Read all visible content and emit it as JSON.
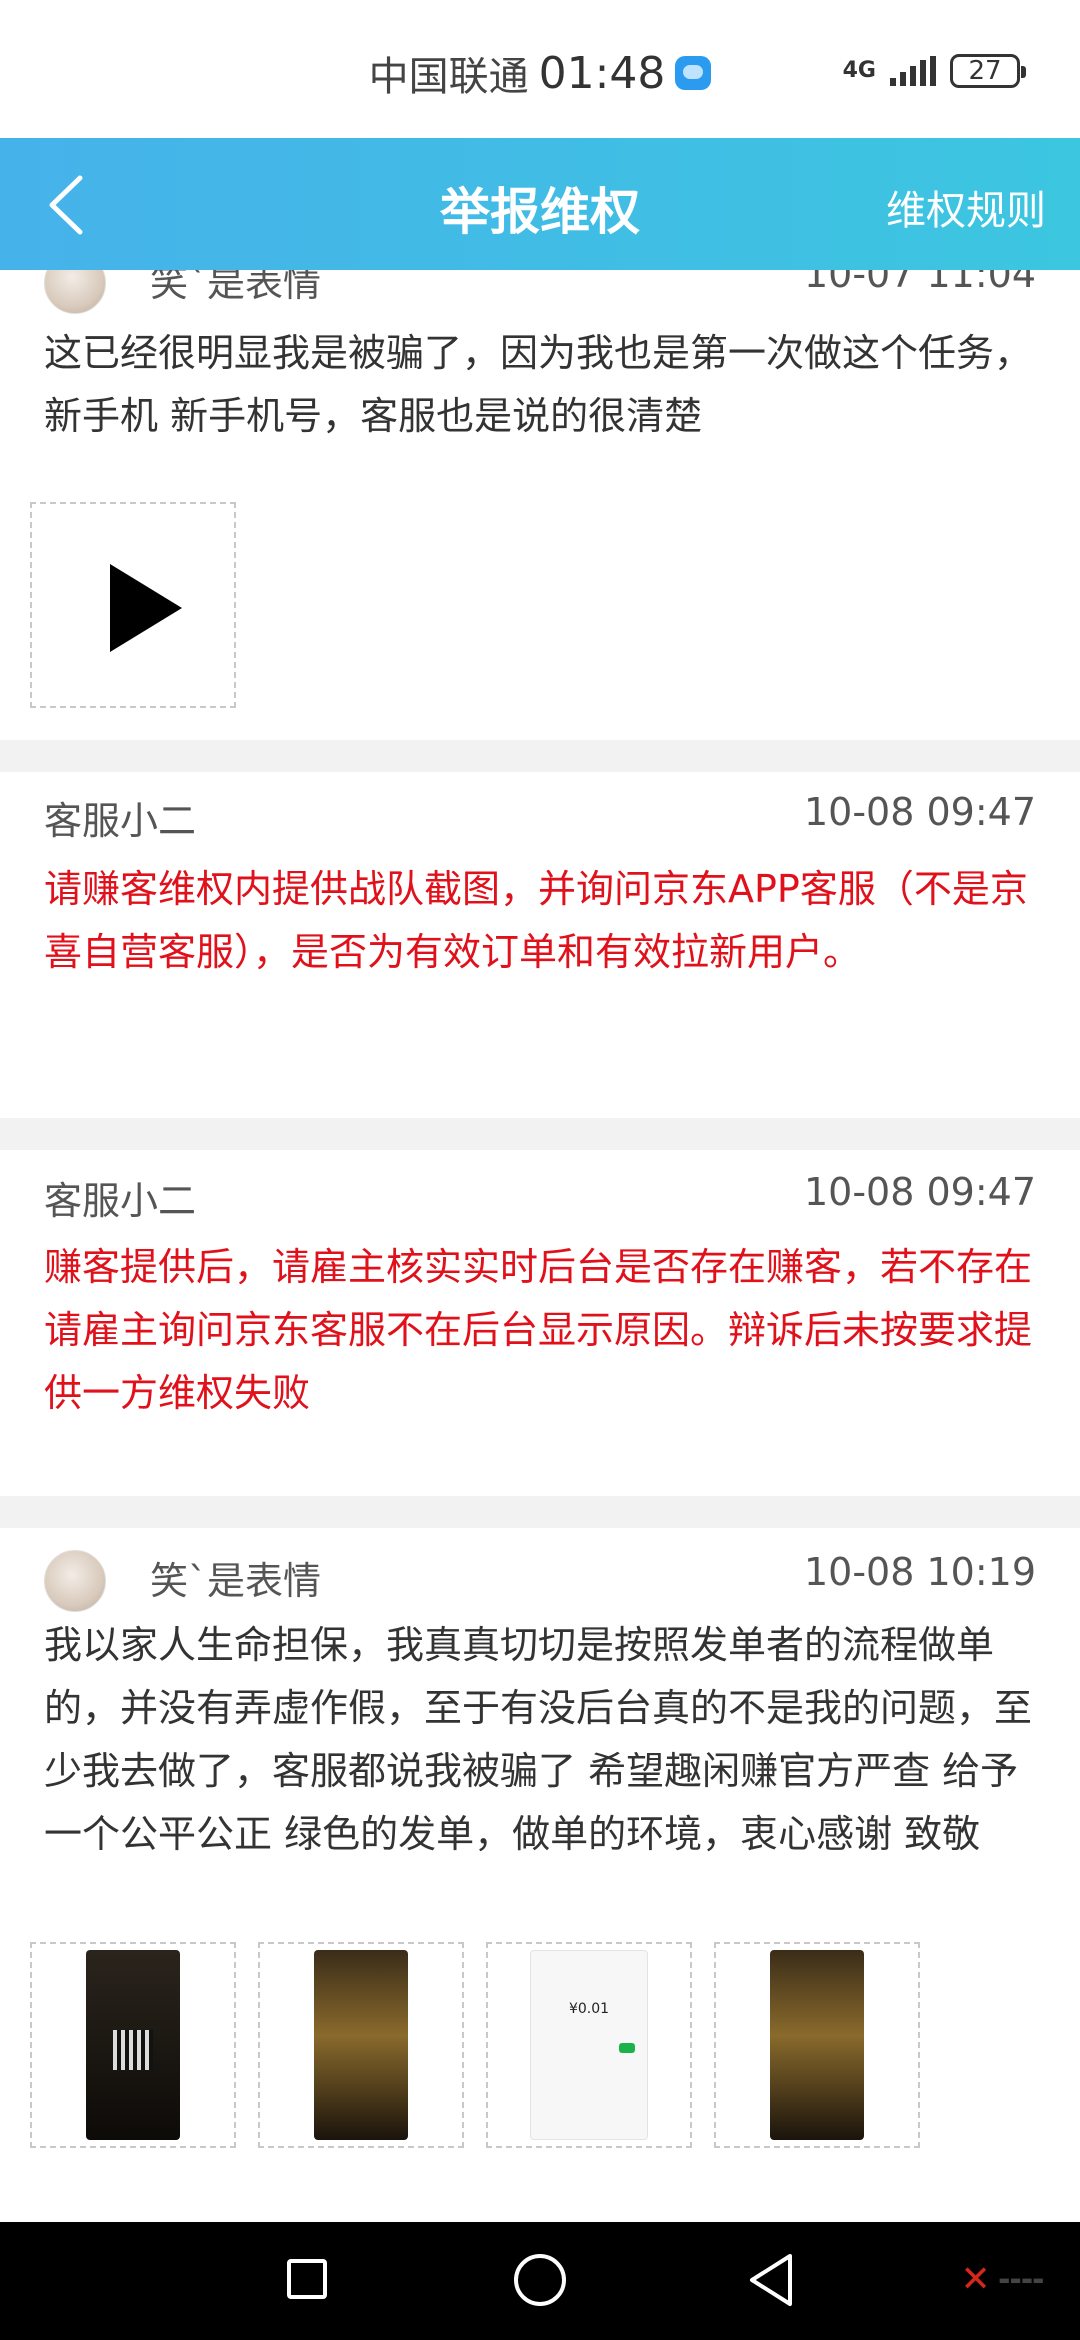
{
  "status_bar": {
    "carrier": "中国联通",
    "time": "01:48",
    "network": "4G",
    "battery": "27"
  },
  "header": {
    "title": "举报维权",
    "right_link": "维权规则"
  },
  "messages": [
    {
      "author": "笑`是表情",
      "time": "10-07 11:04",
      "text": "这已经很明显我是被骗了，因为我也是第一次做这个任务，新手机 新手机号，客服也是说的很清楚"
    },
    {
      "author": "客服小二",
      "time": "10-08 09:47",
      "text": "请赚客维权内提供战队截图，并询问京东APP客服（不是京喜自营客服），是否为有效订单和有效拉新用户。"
    },
    {
      "author": "客服小二",
      "time": "10-08 09:47",
      "text": "赚客提供后，请雇主核实实时后台是否存在赚客，若不存在请雇主询问京东客服不在后台显示原因。辩诉后未按要求提供一方维权失败"
    },
    {
      "author": "笑`是表情",
      "time": "10-08 10:19",
      "text": "我以家人生命担保，我真真切切是按照发单者的流程做单的，并没有弄虚作假，至于有没后台真的不是我的问题，至少我去做了，客服都说我被骗了 希望趣闲赚官方严查 给予一个公平公正 绿色的发单，做单的环境，衷心感谢 致敬"
    }
  ],
  "attachment_icons": [
    "play-icon"
  ],
  "screenshot_price": "¥0.01",
  "icons": {
    "back": "back-arrow-icon",
    "nav_recent": "square-icon",
    "nav_home": "circle-icon",
    "nav_back": "triangle-back-icon"
  },
  "colors": {
    "header_gradient_start": "#46b2ea",
    "header_gradient_end": "#3cc6e0",
    "staff_text": "#e0111b",
    "separator": "#f2f2f2"
  }
}
